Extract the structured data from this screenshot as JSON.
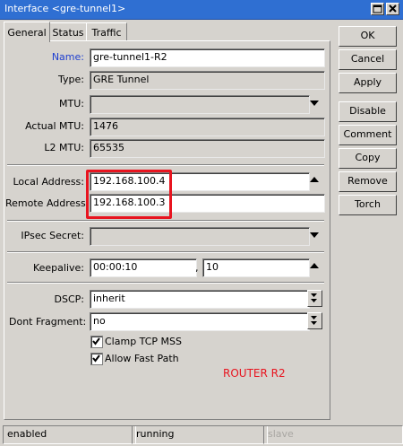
{
  "window": {
    "title": "Interface <gre-tunnel1>"
  },
  "tabs": [
    {
      "label": "General"
    },
    {
      "label": "Status"
    },
    {
      "label": "Traffic"
    }
  ],
  "form": {
    "name": {
      "label": "Name:",
      "value": "gre-tunnel1-R2"
    },
    "type": {
      "label": "Type:",
      "value": "GRE Tunnel"
    },
    "mtu": {
      "label": "MTU:",
      "value": ""
    },
    "actual_mtu": {
      "label": "Actual MTU:",
      "value": "1476"
    },
    "l2_mtu": {
      "label": "L2 MTU:",
      "value": "65535"
    },
    "local_address": {
      "label": "Local Address:",
      "value": "192.168.100.4"
    },
    "remote_address": {
      "label": "Remote Address:",
      "value": "192.168.100.3"
    },
    "ipsec_secret": {
      "label": "IPsec Secret:",
      "value": ""
    },
    "keepalive": {
      "label": "Keepalive:",
      "interval": "00:00:10",
      "separator": ",",
      "retries": "10"
    },
    "dscp": {
      "label": "DSCP:",
      "value": "inherit"
    },
    "dont_fragment": {
      "label": "Dont Fragment:",
      "value": "no"
    },
    "clamp_tcp_mss": {
      "label": "Clamp TCP MSS",
      "checked": true
    },
    "allow_fast_path": {
      "label": "Allow Fast Path",
      "checked": true
    }
  },
  "annotation": {
    "text": "ROUTER R2",
    "color": "#e8141f"
  },
  "buttons": {
    "ok": "OK",
    "cancel": "Cancel",
    "apply": "Apply",
    "disable": "Disable",
    "comment": "Comment",
    "copy": "Copy",
    "remove": "Remove",
    "torch": "Torch"
  },
  "status_bar": {
    "state": "enabled",
    "running": "running",
    "slave": "slave"
  },
  "colors": {
    "titlebar": "#2f6fd2",
    "label_accent": "#1f3fd0",
    "highlight": "#e8141f"
  }
}
